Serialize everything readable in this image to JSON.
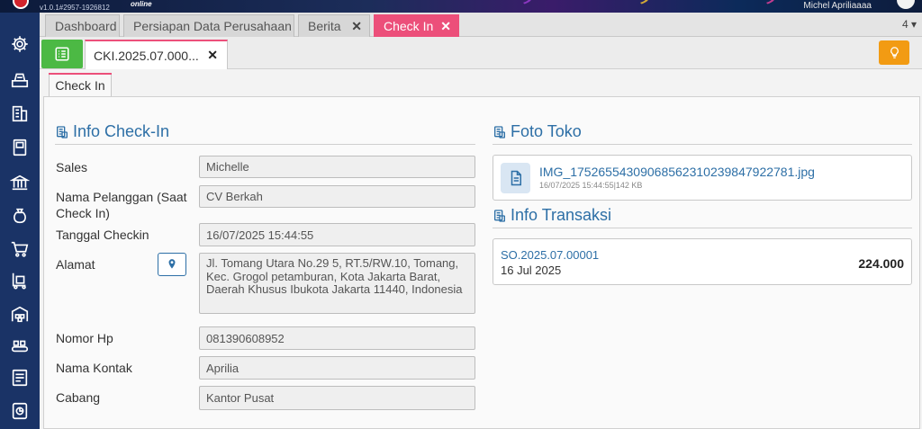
{
  "app": {
    "version": "v1.0.1#2957-1926812",
    "edition": "online",
    "user": "Michel Apriliaaaa"
  },
  "tabs": [
    {
      "label": "Dashboard",
      "closable": false
    },
    {
      "label": "Persiapan Data Perusahaan",
      "closable": false
    },
    {
      "label": "Berita",
      "closable": true
    },
    {
      "label": "Check In",
      "closable": true,
      "active": true
    }
  ],
  "tab_count": "4",
  "document_tab": {
    "label": "CKI.2025.07.000..."
  },
  "inner_tab": "Check In",
  "info_checkin": {
    "title": "Info Check-In",
    "fields": {
      "sales": {
        "label": "Sales",
        "value": "Michelle"
      },
      "pelanggan": {
        "label_line1": "Nama Pelanggan (Saat",
        "label_line2": "Check In)",
        "value": "CV Berkah"
      },
      "tanggal": {
        "label": "Tanggal Checkin",
        "value": "16/07/2025 15:44:55"
      },
      "alamat": {
        "label": "Alamat",
        "line1": "Jl. Tomang Utara No.29 5, RT.5/RW.10, Tomang,",
        "line2": "Kec. Grogol petamburan, Kota Jakarta Barat,",
        "line3": "Daerah Khusus Ibukota Jakarta 11440, Indonesia"
      },
      "nomor_hp": {
        "label": "Nomor Hp",
        "value": "081390608952"
      },
      "kontak": {
        "label": "Nama Kontak",
        "value": "Aprilia"
      },
      "cabang": {
        "label": "Cabang",
        "value": "Kantor Pusat"
      }
    }
  },
  "foto_toko": {
    "title": "Foto Toko",
    "file_name": "IMG_17526554309068562310239847922781.jpg",
    "file_meta": "16/07/2025 15:44:55|142 KB"
  },
  "info_transaksi": {
    "title": "Info Transaksi",
    "number": "SO.2025.07.00001",
    "date": "16 Jul 2025",
    "amount": "224.000"
  },
  "colors": {
    "sidebar": "#1a3366",
    "active_tab": "#ec4f7a",
    "accent_blue": "#2d6fa6",
    "list_button": "#4cb944",
    "bulb_button": "#f29b13"
  },
  "icons": {
    "sidebar": [
      "settings-icon",
      "cashier-icon",
      "building-icon",
      "book-icon",
      "bank-icon",
      "money-bag-icon",
      "cart-icon",
      "trolley-icon",
      "warehouse-icon",
      "conveyor-icon",
      "tax-icon",
      "report-icon"
    ]
  }
}
